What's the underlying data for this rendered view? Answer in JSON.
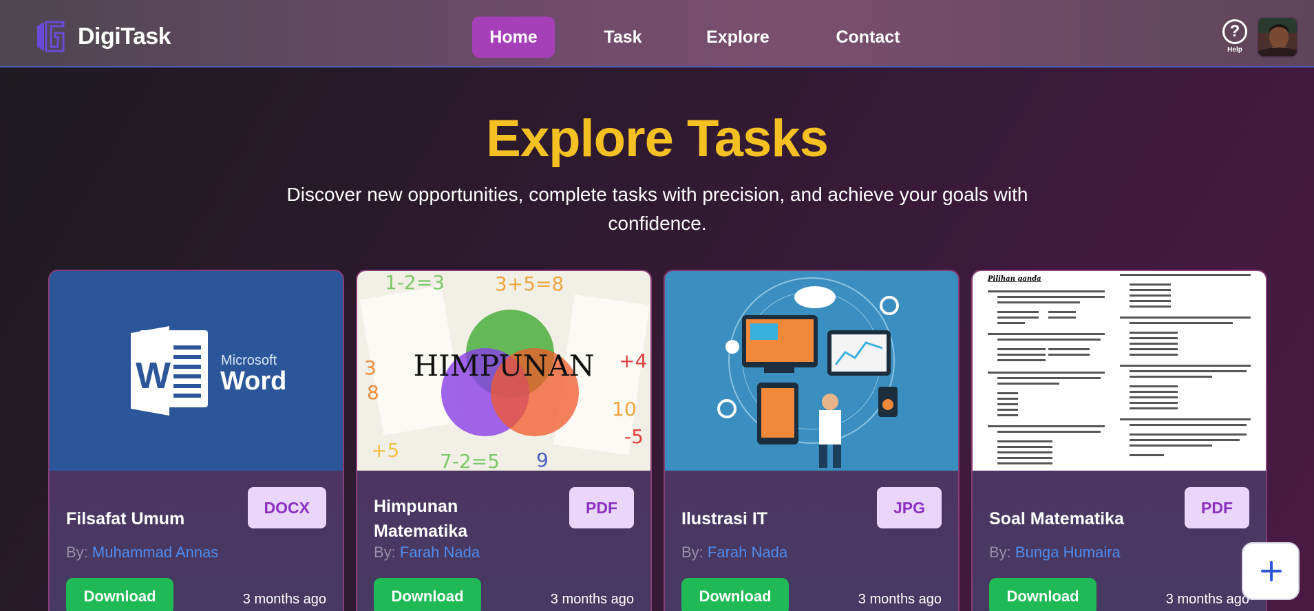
{
  "nav": {
    "brand": "DigiTask",
    "links": [
      "Home",
      "Task",
      "Explore",
      "Contact"
    ],
    "active": "Home",
    "help_label": "Help",
    "accent": "#a640b8"
  },
  "hero": {
    "title": "Explore Tasks",
    "subtitle": "Discover new opportunities, complete tasks with precision, and achieve your goals with confidence."
  },
  "cards": [
    {
      "title": "Filsafat Umum",
      "type": "DOCX",
      "by_prefix": "By: ",
      "author": "Muhammad Annas",
      "action": "Download",
      "time": "3 months ago",
      "image": "microsoft-word-logo",
      "image_text": [
        "Microsoft",
        "Word"
      ]
    },
    {
      "title": "Himpunan Matematika",
      "type": "PDF",
      "by_prefix": "By: ",
      "author": "Farah Nada",
      "action": "Download",
      "time": "3 months ago",
      "image": "venn-diagram",
      "image_text": [
        "HIMPUNAN"
      ]
    },
    {
      "title": "Ilustrasi IT",
      "type": "JPG",
      "by_prefix": "By: ",
      "author": "Farah Nada",
      "action": "Download",
      "time": "3 months ago",
      "image": "it-illustration"
    },
    {
      "title": "Soal Matematika",
      "type": "PDF",
      "by_prefix": "By: ",
      "author": "Bunga Humaira",
      "action": "Download",
      "time": "3 months ago",
      "image": "math-worksheet",
      "image_text": [
        "Pilihan ganda"
      ]
    }
  ],
  "fab": {
    "icon": "plus-icon"
  },
  "colors": {
    "title": "#f5c022",
    "download": "#1fba55",
    "badge_bg": "#ead5fb",
    "badge_text": "#8a2fc2",
    "author": "#4e8cf0"
  }
}
